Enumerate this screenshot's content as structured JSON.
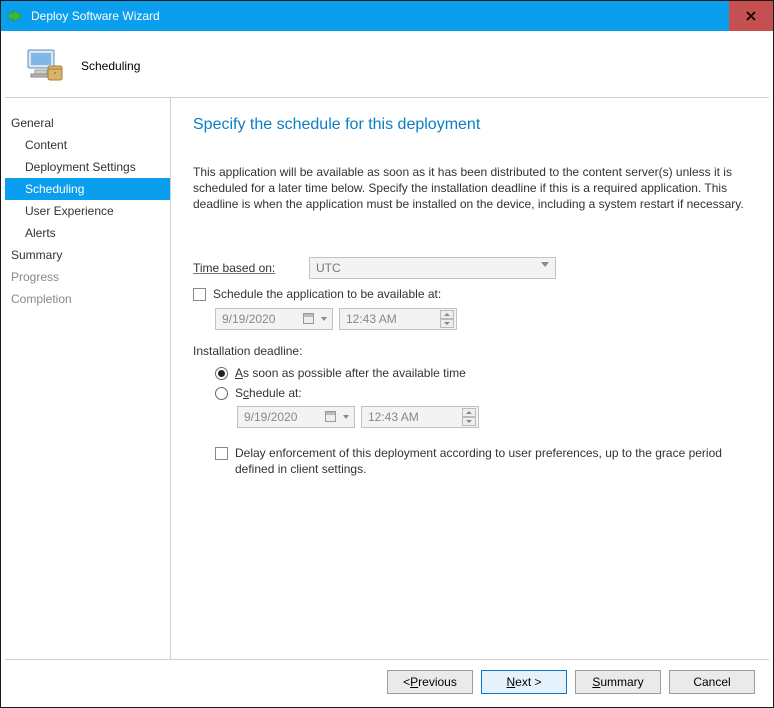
{
  "window": {
    "title": "Deploy Software Wizard"
  },
  "header": {
    "step_title": "Scheduling"
  },
  "sidebar": {
    "items": [
      {
        "label": "General",
        "level": 0,
        "active": false,
        "dim": false
      },
      {
        "label": "Content",
        "level": 1,
        "active": false,
        "dim": false
      },
      {
        "label": "Deployment Settings",
        "level": 1,
        "active": false,
        "dim": false
      },
      {
        "label": "Scheduling",
        "level": 1,
        "active": true,
        "dim": false
      },
      {
        "label": "User Experience",
        "level": 1,
        "active": false,
        "dim": false
      },
      {
        "label": "Alerts",
        "level": 1,
        "active": false,
        "dim": false
      },
      {
        "label": "Summary",
        "level": 0,
        "active": false,
        "dim": false
      },
      {
        "label": "Progress",
        "level": 0,
        "active": false,
        "dim": true
      },
      {
        "label": "Completion",
        "level": 0,
        "active": false,
        "dim": true
      }
    ]
  },
  "content": {
    "heading": "Specify the schedule for this deployment",
    "description": "This application will be available as soon as it has been distributed to the content server(s) unless it is scheduled for a later time below. Specify the installation deadline if this is a required application. This deadline is when the application must be installed on the device, including a system restart if necessary.",
    "time_based_label": "Time based on:",
    "time_based_value": "UTC",
    "schedule_available_label": "Schedule the application to be available at:",
    "schedule_available_checked": false,
    "available_date": "9/19/2020",
    "available_time": "12:43 AM",
    "deadline_label": "Installation deadline:",
    "radio_asap_label": "As soon as possible after the available time",
    "radio_schedule_label": "Schedule at:",
    "radio_selected": "asap",
    "deadline_date": "9/19/2020",
    "deadline_time": "12:43 AM",
    "delay_label": "Delay enforcement of this deployment according to user preferences, up to the grace period defined in client settings.",
    "delay_checked": false
  },
  "footer": {
    "previous": "< Previous",
    "next": "Next >",
    "summary": "Summary",
    "cancel": "Cancel"
  }
}
